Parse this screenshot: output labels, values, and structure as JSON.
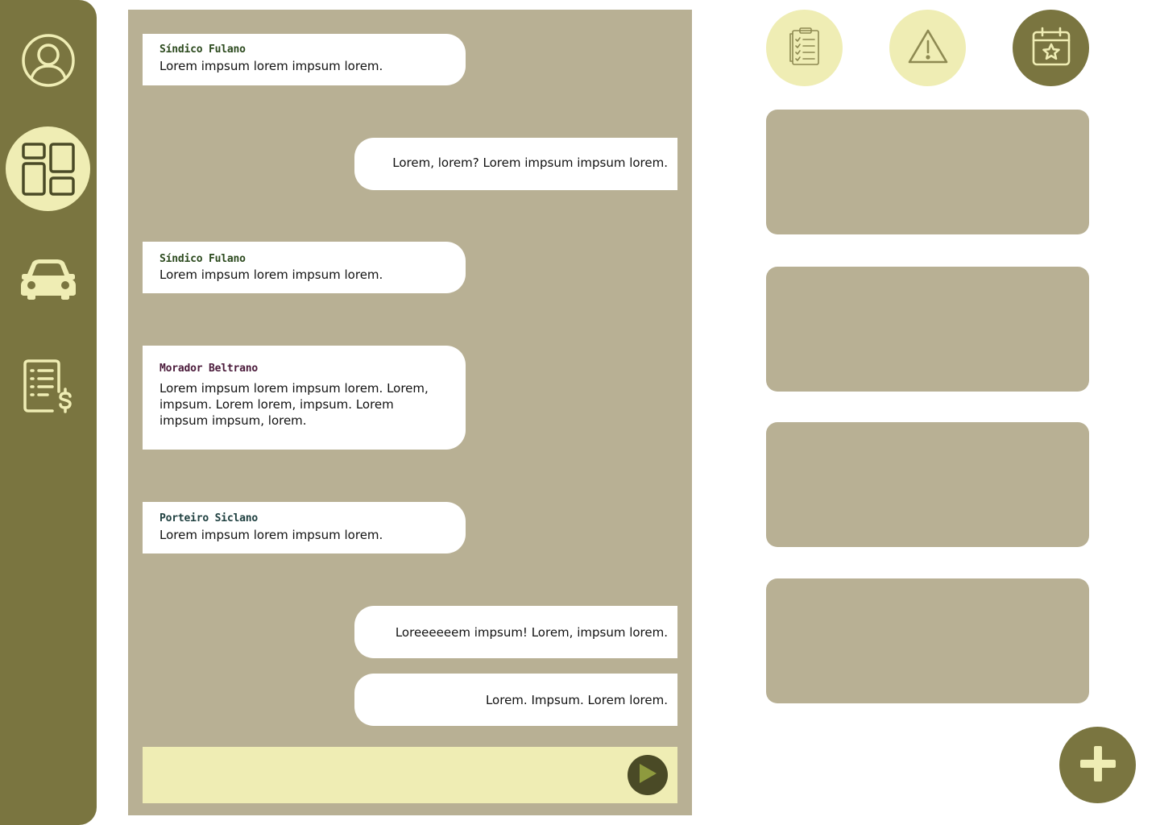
{
  "sidebar": {
    "items": [
      {
        "icon": "user-profile-icon",
        "active": false
      },
      {
        "icon": "dashboard-icon",
        "active": true
      },
      {
        "icon": "car-icon",
        "active": false
      },
      {
        "icon": "bill-invoice-icon",
        "active": false
      }
    ]
  },
  "chat": {
    "messages": [
      {
        "side": "left",
        "sender": "Síndico Fulano",
        "text": "Lorem impsum lorem impsum lorem."
      },
      {
        "side": "right",
        "sender": "",
        "text": "Lorem, lorem? Lorem impsum impsum lorem."
      },
      {
        "side": "left",
        "sender": "Síndico Fulano",
        "text": "Lorem impsum lorem impsum lorem."
      },
      {
        "side": "left",
        "sender": "Morador Beltrano",
        "text": "Lorem impsum lorem impsum lorem. Lorem, impsum. Lorem lorem, impsum. Lorem impsum impsum, lorem."
      },
      {
        "side": "left",
        "sender": "Porteiro Siclano",
        "text": "Lorem impsum lorem impsum lorem."
      },
      {
        "side": "right",
        "sender": "",
        "text": "Loreeeeeem impsum! Lorem, impsum lorem."
      },
      {
        "side": "right",
        "sender": "",
        "text": "Lorem. Impsum. Lorem lorem."
      }
    ],
    "composer": {
      "value": "",
      "placeholder": ""
    }
  },
  "top_actions": [
    {
      "icon": "checklist-icon",
      "active": false
    },
    {
      "icon": "warning-icon",
      "active": false
    },
    {
      "icon": "calendar-star-icon",
      "active": true
    }
  ],
  "colors": {
    "sidebar": "#7a7540",
    "accent_light": "#efedb4",
    "panel": "#b8b094",
    "dark": "#4a4a26",
    "sender_green": "#2c4a1e",
    "sender_purple": "#4a1a3a",
    "sender_teal": "#1f4040"
  }
}
